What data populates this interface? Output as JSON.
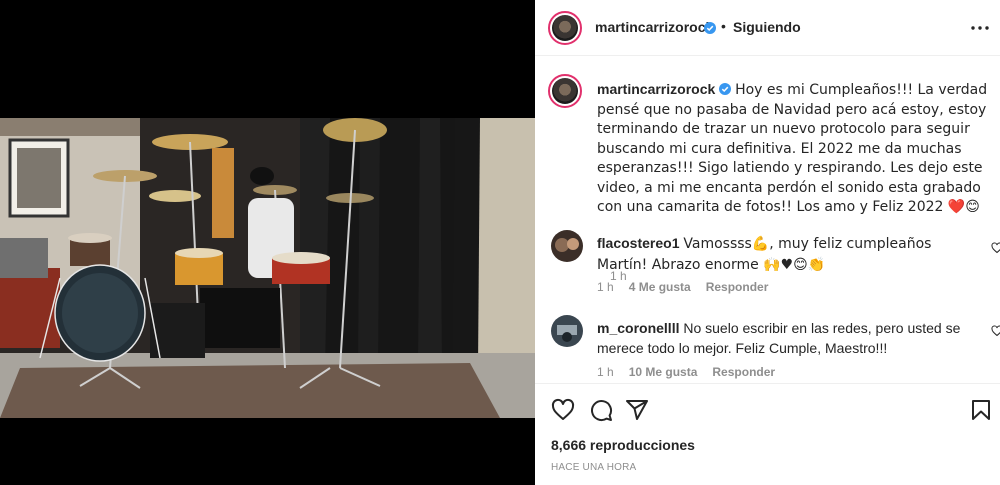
{
  "post": {
    "author": "martincarrizorock",
    "follow_status": "Siguiendo",
    "separator": "•",
    "caption": "Hoy es mi Cumpleaños!!! La verdad pensé que no pasaba de Navidad pero acá estoy, estoy terminando de trazar un nuevo protocolo para seguir buscando mi cura definitiva. El 2022 me da muchas esperanzas!!! Sigo latiendo y respirando. Les dejo este video, a mi me encanta perdón el sonido esta grabado con una camarita de fotos!! Los amo y Feliz 2022 ❤️😊",
    "caption_time": "1 h"
  },
  "comments": [
    {
      "username": "flacostereo1",
      "text": "Vamossss💪, muy feliz cumpleaños Martín! Abrazo enorme 🙌♥😊👏",
      "time": "1 h",
      "likes": "4 Me gusta",
      "reply": "Responder"
    },
    {
      "username": "m_coronellll",
      "text": "No suelo escribir en las redes, pero usted se merece todo lo mejor. Feliz Cumple, Maestro!!!",
      "time": "1 h",
      "likes": "10 Me gusta",
      "reply": "Responder"
    }
  ],
  "stats": {
    "views": "8,666 reproducciones",
    "ago": "HACE UNA HORA"
  },
  "icons": {
    "more": "more-options-icon",
    "like": "heart-icon",
    "comment": "comment-icon",
    "share": "share-icon",
    "save": "bookmark-icon",
    "verified": "verified-badge-icon"
  },
  "colors": {
    "verified": "#3897f0",
    "text": "#262626",
    "secondary": "#8e8e8e",
    "heart": "#ed4956"
  }
}
